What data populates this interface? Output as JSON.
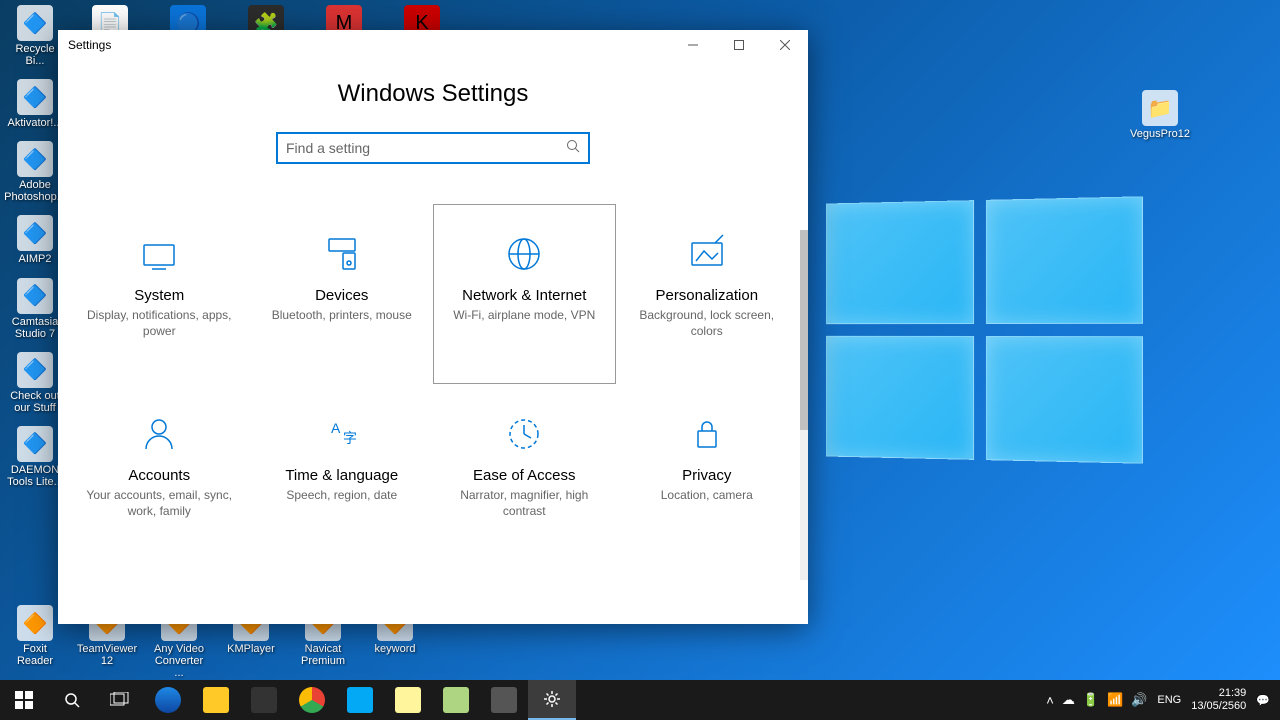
{
  "window": {
    "title": "Settings",
    "heading": "Windows Settings"
  },
  "search": {
    "placeholder": "Find a setting"
  },
  "tiles": [
    {
      "title": "System",
      "desc": "Display, notifications, apps, power"
    },
    {
      "title": "Devices",
      "desc": "Bluetooth, printers, mouse"
    },
    {
      "title": "Network & Internet",
      "desc": "Wi-Fi, airplane mode, VPN"
    },
    {
      "title": "Personalization",
      "desc": "Background, lock screen, colors"
    },
    {
      "title": "Accounts",
      "desc": "Your accounts, email, sync, work, family"
    },
    {
      "title": "Time & language",
      "desc": "Speech, region, date"
    },
    {
      "title": "Ease of Access",
      "desc": "Narrator, magnifier, high contrast"
    },
    {
      "title": "Privacy",
      "desc": "Location, camera"
    }
  ],
  "desktop_icons_col": [
    "Recycle Bi...",
    "Aktivator!...",
    "Adobe Photoshop...",
    "AIMP2",
    "Camtasia Studio 7",
    "Check out our Stuff",
    "DAEMON Tools Lite..."
  ],
  "desktop_icons_bottom": [
    "Foxit Reader",
    "TeamViewer 12",
    "Any Video Converter ...",
    "KMPlayer",
    "Navicat Premium",
    "keyword"
  ],
  "desktop_right": "VegusPro12",
  "systray": {
    "lang": "ENG",
    "time": "21:39",
    "date": "13/05/2560"
  }
}
